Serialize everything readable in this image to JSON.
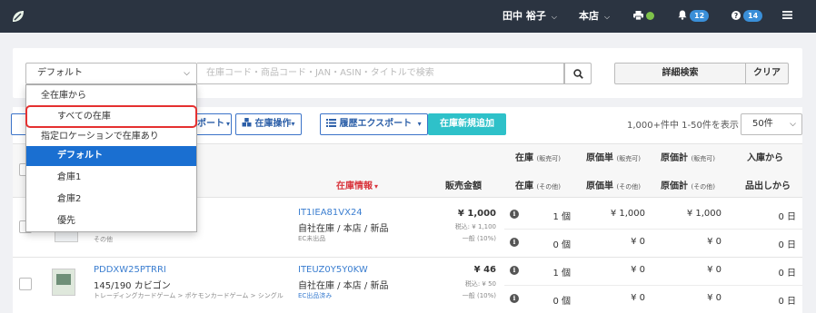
{
  "topbar": {
    "user_name": "田中 裕子",
    "store": "本店",
    "notifications_count": "12",
    "help_count": "14"
  },
  "search": {
    "location_select_value": "デフォルト",
    "placeholder": "在庫コード・商品コード・JAN・ASIN・タイトルで検索",
    "advanced_search_label": "詳細検索",
    "clear_label": "クリア"
  },
  "toolbar": {
    "export_label": "ポート",
    "stock_ops_label": "在庫操作",
    "history_export_label": "履歴エクスポート",
    "add_stock_label": "在庫新規追加",
    "count_text": "1,000+件中 1-50件を表示",
    "per_page": "50件"
  },
  "columns": {
    "stock_info": "在庫情報",
    "price": "販売金額",
    "stock_avail": "在庫",
    "stock_avail_sub": "(販売可)",
    "stock_other": "在庫",
    "stock_other_sub": "(その他)",
    "cost": "原価単",
    "cost_sub": "(販売可)",
    "cost_other": "原価単",
    "cost_other_sub": "(その他)",
    "total": "原価計",
    "total_sub": "(販売可)",
    "total_other": "原価計",
    "total_other_sub": "(その他)",
    "since_in": "入庫から",
    "since_out": "品出しから"
  },
  "dropdown": {
    "group_all": "全在庫から",
    "opt_all": "すべての在庫",
    "group_loc": "指定ロケーションで在庫あり",
    "opt_default": "デフォルト",
    "opt_wh1": "倉庫1",
    "opt_wh2": "倉庫2",
    "opt_priority": "優先"
  },
  "rows": [
    {
      "category": "その他",
      "stock_id": "IT1IEA81VX24",
      "location": "自社在庫 / 本店 / 新品",
      "ec_status": "EC未出品",
      "price": "¥ 1,000",
      "price_tax": "税込: ¥ 1,100",
      "tax_class": "一般 (10%)",
      "avail_qty": "1 個",
      "avail_cost": "¥ 1,000",
      "avail_total": "¥ 1,000",
      "avail_days": "0 日",
      "other_qty": "0 個",
      "other_cost": "¥ 0",
      "other_total": "¥ 0",
      "other_days": "0 日"
    },
    {
      "product_code": "PDDXW25PTRRI",
      "product_name": "145/190 カビゴン",
      "breadcrumb": "トレーディングカードゲーム > ポケモンカードゲーム > シングル",
      "stock_id": "ITEUZ0Y5Y0KW",
      "location": "自社在庫 / 本店 / 新品",
      "ec_status": "EC出品済み",
      "price": "¥ 46",
      "price_tax": "税込: ¥ 50",
      "tax_class": "一般 (10%)",
      "avail_qty": "1 個",
      "avail_cost": "¥ 0",
      "avail_total": "¥ 0",
      "avail_days": "0 日",
      "other_qty": "0 個",
      "other_cost": "¥ 0",
      "other_total": "¥ 0",
      "other_days": "0 日"
    }
  ]
}
